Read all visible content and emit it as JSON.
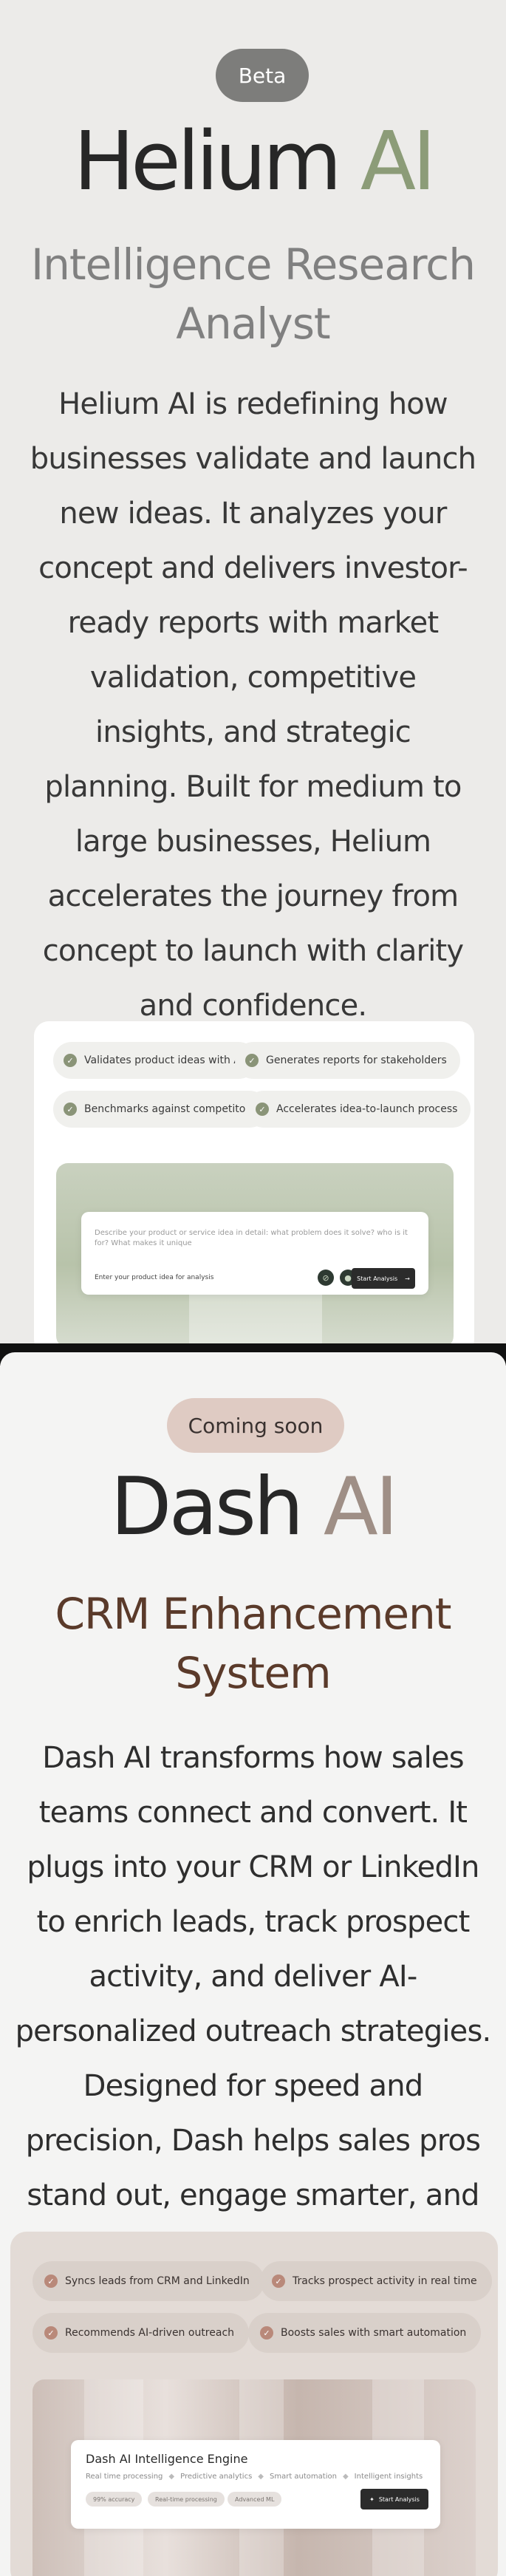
{
  "helium": {
    "badge": "Beta",
    "brand_main": "Helium",
    "brand_accent": "AI",
    "subtitle": "Intelligence Research Analyst",
    "description": "Helium AI is redefining how businesses validate and launch new ideas. It analyzes your concept and delivers investor-ready reports with market validation, competitive insights, and strategic planning. Built for medium to large businesses, Helium accelerates the journey from concept to launch with clarity and confidence.",
    "features": [
      "Validates product ideas with AI",
      "Generates reports for stakeholders",
      "Benchmarks against competitors",
      "Accelerates idea-to-launch process"
    ],
    "input_placeholder": "Describe your product or service idea in detail: what problem does it solve? who is it for? What makes it unique",
    "input_footer": "Enter your product idea for analysis",
    "start_button": "Start Analysis",
    "colors": {
      "accent": "#8c9c78",
      "background": "#ecebe9"
    }
  },
  "dash": {
    "badge": "Coming soon",
    "brand_main": "Dash",
    "brand_accent": "AI",
    "subtitle": "CRM Enhancement System",
    "description": "Dash AI transforms how sales teams connect and convert. It plugs into your CRM or LinkedIn to enrich leads, track prospect activity, and deliver AI-personalized outreach strategies. Designed for speed and precision, Dash helps sales pros stand out, engage smarter, and close faster.",
    "features": [
      "Syncs leads from CRM and LinkedIn",
      "Tracks prospect activity in real time",
      "Recommends AI-driven outreach",
      "Boosts sales with smart automation"
    ],
    "engine_title": "Dash AI Intelligence Engine",
    "engine_features": [
      "Real time processing",
      "Predictive analytics",
      "Smart automation",
      "Intelligent insights"
    ],
    "tags": [
      "99% accuracy",
      "Real-time processing",
      "Advanced ML"
    ],
    "start_button": "Start Analysis",
    "colors": {
      "accent": "#9f8f86",
      "subtitle": "#5a3a2a",
      "badge": "#dfcbc3"
    }
  },
  "icons": [
    "check-icon",
    "attach-icon",
    "mic-icon",
    "arrow-right-icon",
    "sparkle-icon"
  ]
}
